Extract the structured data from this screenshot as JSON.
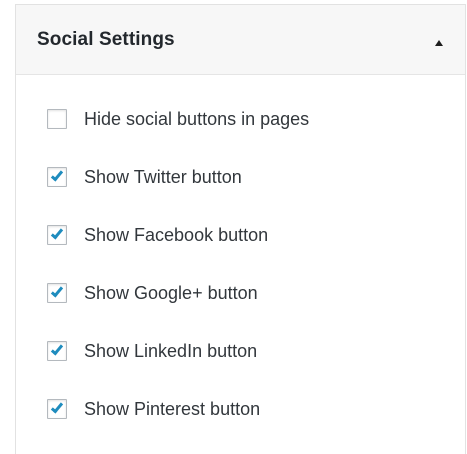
{
  "panel": {
    "title": "Social Settings",
    "toggle_icon": "triangle-up-icon"
  },
  "options": [
    {
      "label": "Hide social buttons in pages",
      "checked": false
    },
    {
      "label": "Show Twitter button",
      "checked": true
    },
    {
      "label": "Show Facebook button",
      "checked": true
    },
    {
      "label": "Show Google+ button",
      "checked": true
    },
    {
      "label": "Show LinkedIn button",
      "checked": true
    },
    {
      "label": "Show Pinterest button",
      "checked": true
    }
  ],
  "colors": {
    "checkmark": "#1e8cbe",
    "header_bg": "#f7f7f7",
    "text": "#32373c"
  }
}
